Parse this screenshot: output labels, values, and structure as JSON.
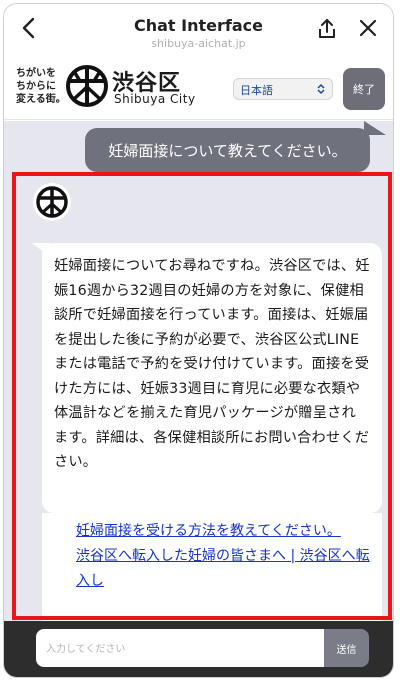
{
  "browser": {
    "title": "Chat Interface",
    "url": "shibuya-aichat.jp"
  },
  "header": {
    "tagline": [
      "ちがいを",
      "ちからに",
      "変える街。"
    ],
    "logo_name": "渋谷区",
    "logo_sub": "Shibuya City",
    "language": "日本語",
    "end_label": "終了"
  },
  "chat": {
    "user_message": "妊婦面接について教えてください。",
    "bot_message": "妊婦面接についてお尋ねですね。渋谷区では、妊娠16週から32週目の妊婦の方を対象に、保健相談所で妊婦面接を行っています。面接は、妊娠届を提出した後に予約が必要で、渋谷区公式LINEまたは電話で予約を受け付けています。面接を受けた方には、妊娠33週目に育児に必要な衣類や体温計などを揃えた育児パッケージが贈呈されます。詳細は、各保健相談所にお問い合わせください。",
    "links": [
      "妊婦面接を受ける方法を教えてください。",
      "渋谷区へ転入した妊婦の皆さまへ | 渋谷区へ転入し"
    ]
  },
  "input": {
    "placeholder": "入力してください",
    "send_label": "送信"
  },
  "colors": {
    "chat_bg": "#e6e6ef",
    "user_bubble": "#6f727d",
    "link": "#1534c8",
    "highlight": "#e8151b",
    "input_bar": "#2d2d2d"
  }
}
